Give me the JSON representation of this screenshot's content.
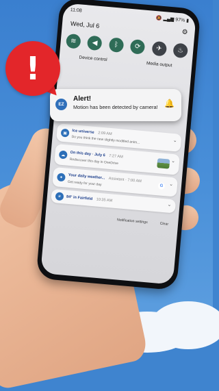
{
  "status_bar": {
    "time": "11:08",
    "battery": "97%",
    "icons": [
      "mute-icon",
      "signal-icon",
      "battery-icon"
    ]
  },
  "panel": {
    "date": "Wed, Jul 6",
    "quick_toggles": [
      {
        "icon": "wifi-icon",
        "glyph": "≋",
        "active": true
      },
      {
        "icon": "sound-off-icon",
        "glyph": "🔇",
        "active": true
      },
      {
        "icon": "bluetooth-icon",
        "glyph": "ᛒ",
        "active": true
      },
      {
        "icon": "auto-rotate-icon",
        "glyph": "⟳",
        "active": true
      },
      {
        "icon": "airplane-icon",
        "glyph": "✈",
        "active": false
      },
      {
        "icon": "flashlight-icon",
        "glyph": "🔦",
        "active": false
      }
    ],
    "device_control": "Device control",
    "media_output": "Media output"
  },
  "alert": {
    "badge": "EZ",
    "title": "Alert!",
    "message": "Motion has been detected by camera!",
    "icon": "bell-ring-icon"
  },
  "notifications": [
    {
      "title": "Ice universe",
      "time": "2:09 AM",
      "text": "Do you think the new slightly modified anim...",
      "extra": "none"
    },
    {
      "title": "On this day · July 6",
      "time": "7:27 AM",
      "text": "Rediscover this day in OneDrive",
      "extra": "thumbnail"
    },
    {
      "title": "Your daily weather...",
      "time": "Assistant · 7:00 AM",
      "text": "Get ready for your day",
      "extra": "google"
    },
    {
      "title": "84° in Fairfield",
      "time": "10:35 AM",
      "text": "",
      "extra": "none"
    }
  ],
  "footer": {
    "notification_settings": "Notification settings",
    "clear": "Clear"
  },
  "warning_mark": "!",
  "colors": {
    "sky": "#4a90d9",
    "alert_red": "#e3262a",
    "app_blue": "#2d6fb8"
  }
}
